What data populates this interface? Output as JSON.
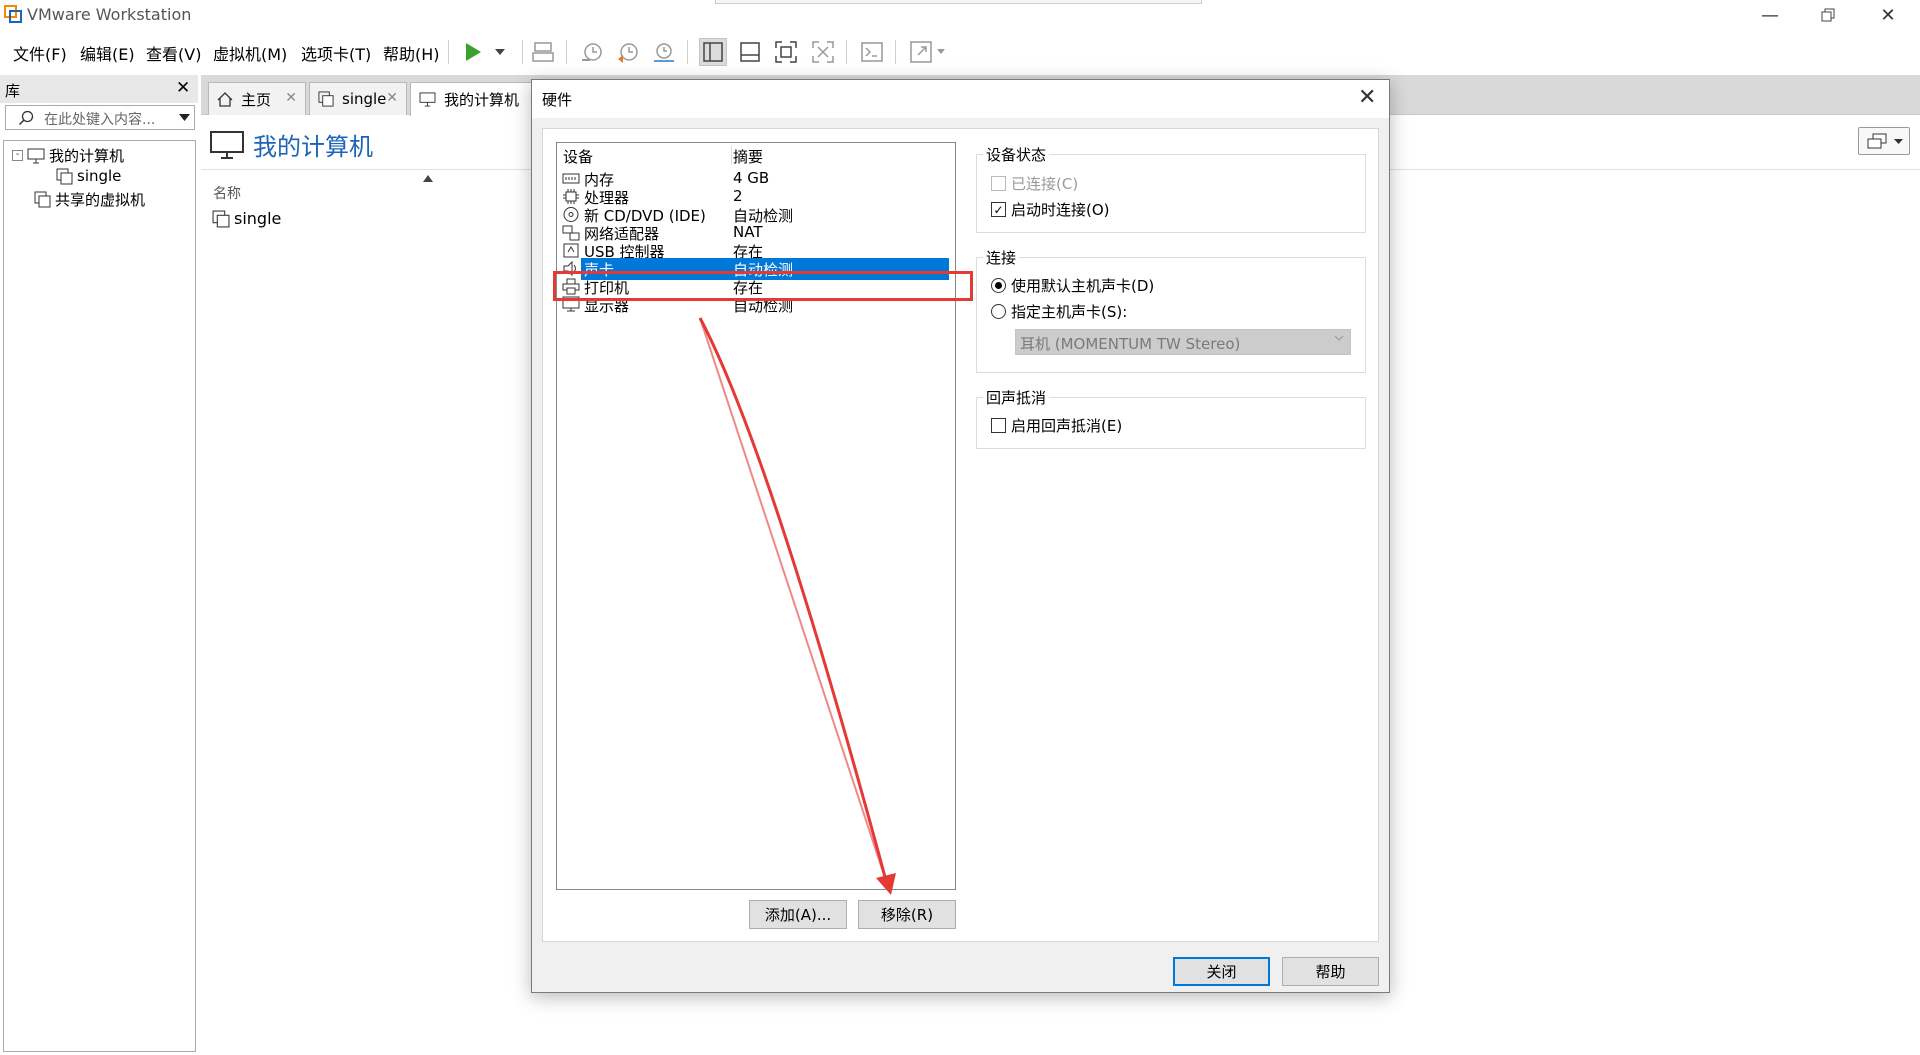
{
  "app": {
    "title": "VMware Workstation",
    "accent": "#0078d7",
    "brand_orange": "#f38b00"
  },
  "menu": {
    "items": [
      "文件(F)",
      "编辑(E)",
      "查看(V)",
      "虚拟机(M)",
      "选项卡(T)",
      "帮助(H)"
    ]
  },
  "toolbar": {
    "icons": [
      "play-icon",
      "dropdown-arrow-icon",
      "send-keys-icon",
      "snapshot-icon",
      "revert-snapshot-icon",
      "manage-snapshots-icon",
      "library-view-icon",
      "thumbnail-bar-icon",
      "full-screen-icon",
      "unity-icon",
      "console-icon",
      "stretch-icon"
    ]
  },
  "library": {
    "title": "库",
    "search_placeholder": "在此处键入内容...",
    "tree": {
      "root": "我的计算机",
      "child": "single",
      "shared": "共享的虚拟机"
    }
  },
  "tabs": [
    {
      "label": "主页"
    },
    {
      "label": "single"
    },
    {
      "label": "我的计算机"
    }
  ],
  "main": {
    "page_title": "我的计算机",
    "column_header": "名称",
    "item": "single"
  },
  "dialog": {
    "title": "硬件",
    "columns": {
      "device": "设备",
      "summary": "摘要"
    },
    "devices": [
      {
        "name": "内存",
        "summary": "4 GB",
        "icon": "memory-icon"
      },
      {
        "name": "处理器",
        "summary": "2",
        "icon": "processor-icon"
      },
      {
        "name": "新 CD/DVD (IDE)",
        "summary": "自动检测",
        "icon": "cd-dvd-icon"
      },
      {
        "name": "网络适配器",
        "summary": "NAT",
        "icon": "network-adapter-icon"
      },
      {
        "name": "USB 控制器",
        "summary": "存在",
        "icon": "usb-controller-icon"
      },
      {
        "name": "声卡",
        "summary": "自动检测",
        "icon": "sound-card-icon",
        "selected": true
      },
      {
        "name": "打印机",
        "summary": "存在",
        "icon": "printer-icon"
      },
      {
        "name": "显示器",
        "summary": "自动检测",
        "icon": "display-icon"
      }
    ],
    "buttons": {
      "add": "添加(A)...",
      "remove": "移除(R)",
      "close": "关闭",
      "help": "帮助"
    },
    "device_status": {
      "label": "设备状态",
      "connected": {
        "label": "已连接(C)",
        "checked": false,
        "disabled": true
      },
      "connect_at_power_on": {
        "label": "启动时连接(O)",
        "checked": true
      }
    },
    "connection": {
      "label": "连接",
      "use_default": {
        "label": "使用默认主机声卡(D)",
        "selected": true
      },
      "specify": {
        "label": "指定主机声卡(S):",
        "selected": false
      },
      "host_sound_card_value": "耳机 (MOMENTUM TW Stereo)"
    },
    "echo_cancel": {
      "label": "回声抵消",
      "enable": {
        "label": "启用回声抵消(E)",
        "checked": false
      }
    }
  },
  "annotation": {
    "color": "#e53935"
  }
}
